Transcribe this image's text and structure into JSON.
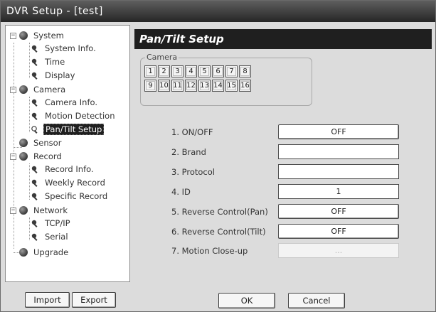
{
  "window": {
    "title": "DVR Setup - [test]"
  },
  "tree": {
    "nodes": [
      {
        "label": "System"
      },
      {
        "label": "System Info."
      },
      {
        "label": "Time"
      },
      {
        "label": "Display"
      },
      {
        "label": "Camera"
      },
      {
        "label": "Camera Info."
      },
      {
        "label": "Motion Detection"
      },
      {
        "label": "Pan/Tilt Setup"
      },
      {
        "label": "Sensor"
      },
      {
        "label": "Record"
      },
      {
        "label": "Record Info."
      },
      {
        "label": "Weekly Record"
      },
      {
        "label": "Specific Record"
      },
      {
        "label": "Network"
      },
      {
        "label": "TCP/IP"
      },
      {
        "label": "Serial"
      },
      {
        "label": "Upgrade"
      }
    ],
    "expander_symbol": "−"
  },
  "panel": {
    "title": "Pan/Tilt Setup",
    "camera_group_label": "Camera",
    "cameras": [
      "1",
      "2",
      "3",
      "4",
      "5",
      "6",
      "7",
      "8",
      "9",
      "10",
      "11",
      "12",
      "13",
      "14",
      "15",
      "16"
    ],
    "rows": [
      {
        "label": "1. ON/OFF",
        "value": "OFF"
      },
      {
        "label": "2. Brand",
        "value": ""
      },
      {
        "label": "3. Protocol",
        "value": ""
      },
      {
        "label": "4. ID",
        "value": "1"
      },
      {
        "label": "5. Reverse Control(Pan)",
        "value": "OFF"
      },
      {
        "label": "6. Reverse Control(Tilt)",
        "value": "OFF"
      },
      {
        "label": "7. Motion Close-up",
        "value": "..."
      }
    ]
  },
  "buttons": {
    "import": "Import",
    "export": "Export",
    "ok": "OK",
    "cancel": "Cancel"
  }
}
